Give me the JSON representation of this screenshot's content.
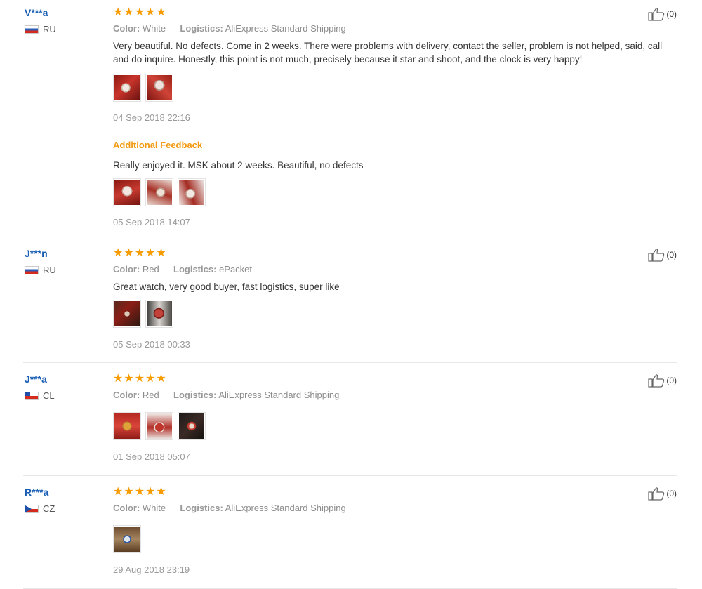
{
  "reviews": [
    {
      "user": "V***a",
      "country_code": "RU",
      "color_label": "Color:",
      "color_value": "White",
      "logistics_label": "Logistics:",
      "logistics_value": "AliExpress Standard Shipping",
      "text": "Very beautiful. No defects. Come in 2 weeks. There were problems with delivery, contact the seller, problem is not helped, said, call and do inquire. Honestly, this point is not much, precisely because it star and shoot, and the clock is very happy!",
      "date": "04 Sep 2018 22:16",
      "likes": "(0)",
      "additional": {
        "heading": "Additional Feedback",
        "text": "Really enjoyed it. MSK about 2 weeks. Beautiful, no defects",
        "date": "05 Sep 2018 14:07"
      }
    },
    {
      "user": "J***n",
      "country_code": "RU",
      "color_label": "Color:",
      "color_value": "Red",
      "logistics_label": "Logistics:",
      "logistics_value": "ePacket",
      "text": "Great watch, very good buyer, fast logistics, super like",
      "date": "05 Sep 2018 00:33",
      "likes": "(0)"
    },
    {
      "user": "J***a",
      "country_code": "CL",
      "color_label": "Color:",
      "color_value": "Red",
      "logistics_label": "Logistics:",
      "logistics_value": "AliExpress Standard Shipping",
      "date": "01 Sep 2018 05:07",
      "likes": "(0)"
    },
    {
      "user": "R***a",
      "country_code": "CZ",
      "color_label": "Color:",
      "color_value": "White",
      "logistics_label": "Logistics:",
      "logistics_value": "AliExpress Standard Shipping",
      "date": "29 Aug 2018 23:19",
      "likes": "(0)"
    }
  ],
  "rating_stars": 5,
  "icons": {
    "star": "star-icon",
    "like": "thumbs-up-icon"
  },
  "colors": {
    "username": "#1a5fb4",
    "star": "#f69b00",
    "additional_feedback": "#f29a12"
  }
}
